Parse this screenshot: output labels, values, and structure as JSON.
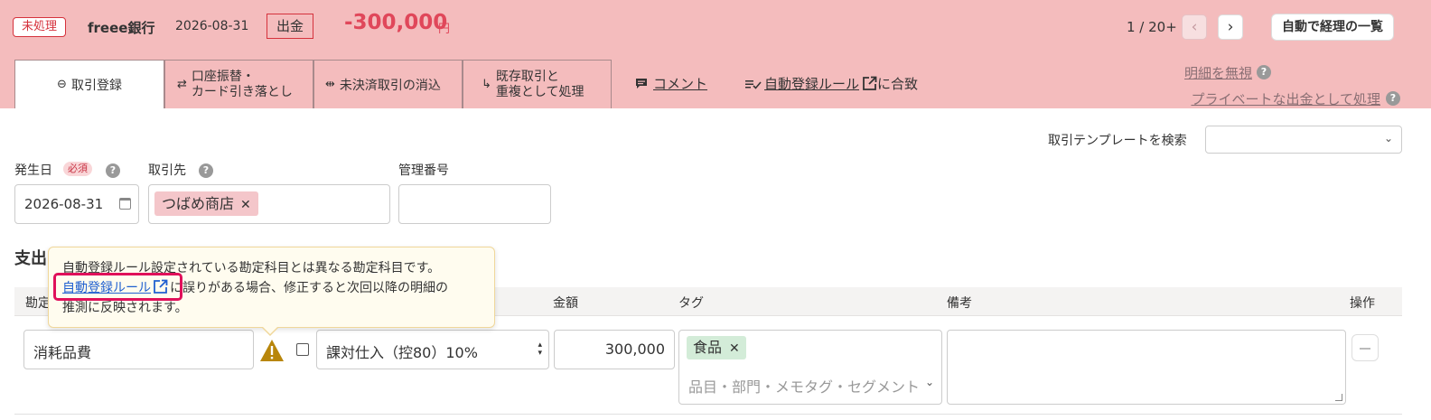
{
  "header": {
    "status": "未処理",
    "bank": "freee銀行",
    "date": "2026-08-31",
    "direction": "出金",
    "amount": "-300,000",
    "unit": "円",
    "pager": "1 / 20+",
    "prev": "‹",
    "next": "›",
    "list_button": "自動で経理の一覧"
  },
  "tabs": [
    {
      "icon": "⊖",
      "label": "取引登録"
    },
    {
      "icon": "⇄",
      "label_line1": "口座振替・",
      "label_line2": "カード引き落とし"
    },
    {
      "icon": "⇹",
      "label": "未決済取引の消込"
    },
    {
      "icon": "↳",
      "label_line1": "既存取引と",
      "label_line2": "重複として処理"
    }
  ],
  "header_links": {
    "comment": "コメント",
    "rule": "自動登録ルール",
    "rule_suffix": "に合致",
    "ignore": "明細を無視",
    "private": "プライベートな出金として処理"
  },
  "form": {
    "template_label": "取引テンプレートを検索",
    "date_label": "発生日",
    "required": "必須",
    "partner_label": "取引先",
    "mgmt_label": "管理番号",
    "date_value": "2026-08-31",
    "partner_value": "つばめ商店"
  },
  "section": {
    "title": "支出"
  },
  "table": {
    "headers": {
      "account": "勘定",
      "amount": "金額",
      "tag": "タグ",
      "memo": "備考",
      "action": "操作"
    },
    "row": {
      "account": "消耗品費",
      "tax": "課対仕入（控80）10%",
      "amount": "300,000",
      "tag": "食品",
      "tag_placeholder": "品目・部門・メモタグ・セグメント"
    }
  },
  "tooltip": {
    "line1": "自動登録ルール設定されている勘定科目とは異なる勘定科目です。",
    "link": "自動登録ルール",
    "line2_rest": "に誤りがある場合、修正すると次回以降の明細の",
    "line3": "推測に反映されます。"
  }
}
